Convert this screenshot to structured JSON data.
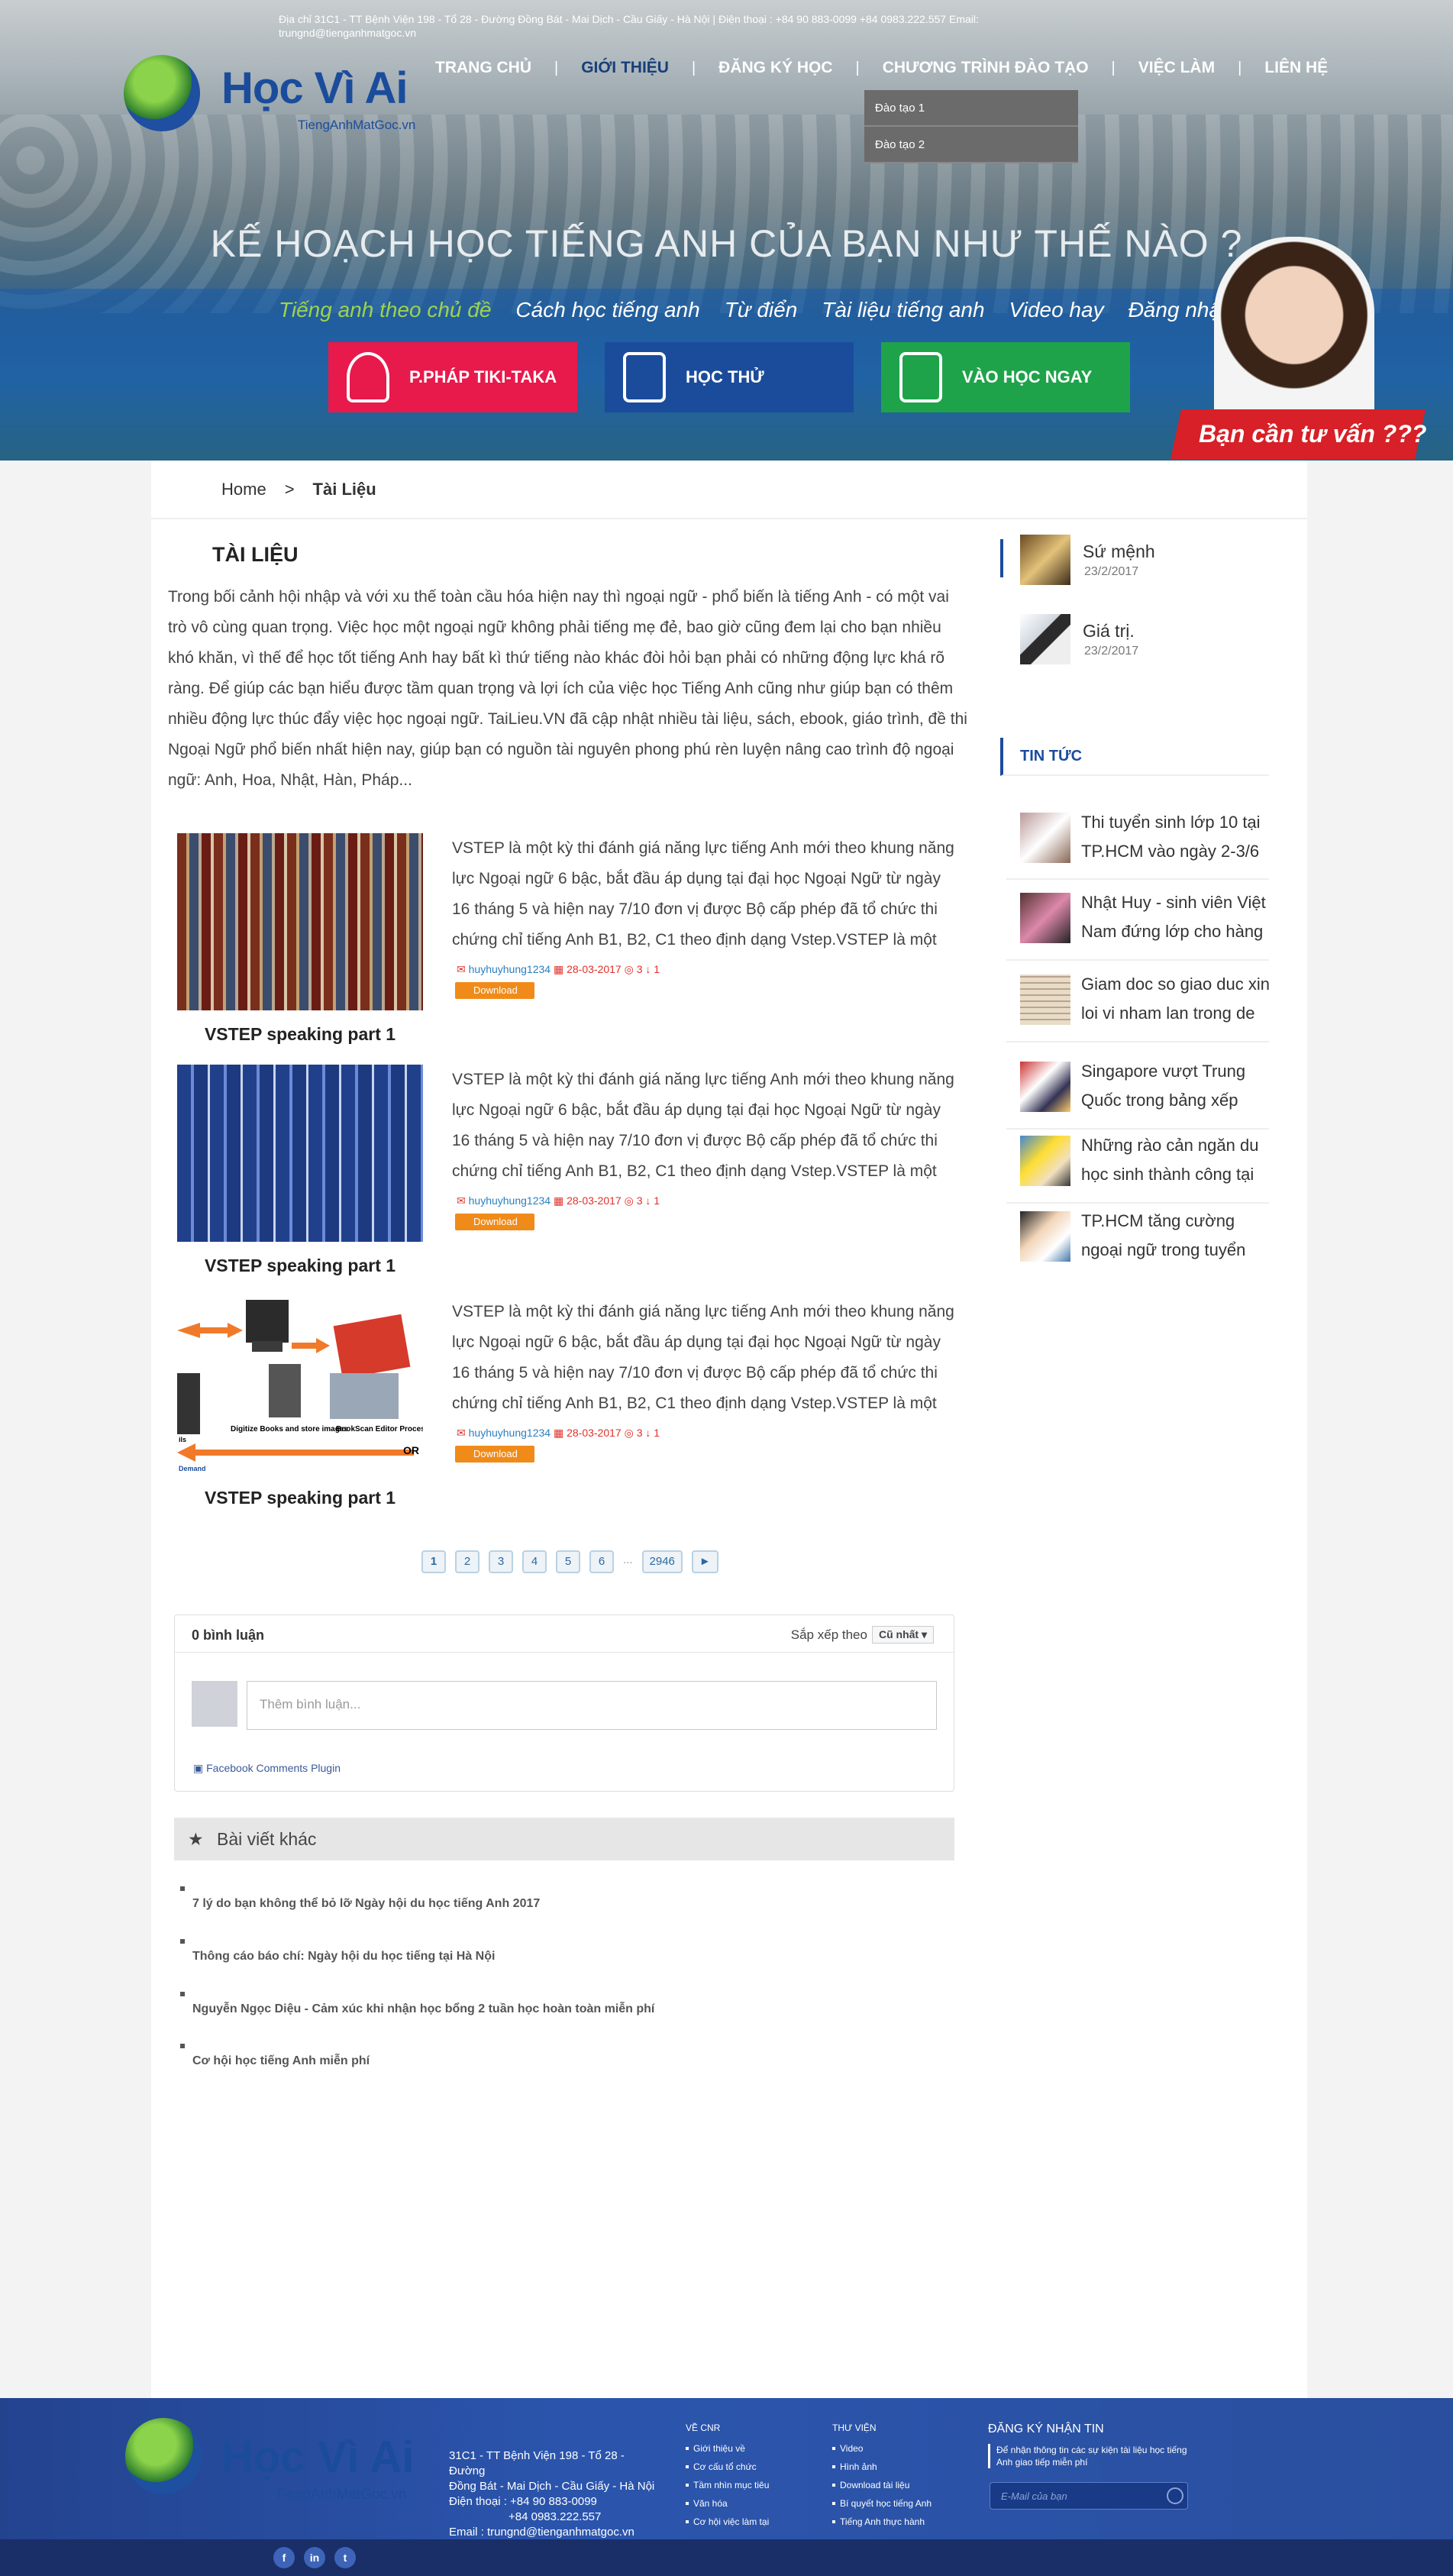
{
  "topbar": {
    "address": "Địa chỉ 31C1 - TT Bệnh Viện 198 - Tổ 28 - Đường Đồng Bát - Mai Dịch - Cầu Giấy - Hà Nội | Điện thoại : +84 90 883-0099 +84 0983.222.557 Email:",
    "email": "trungnd@tienganhmatgoc.vn"
  },
  "logo": {
    "name": "Học Vì Ai",
    "sub": "TiengAnhMatGoc.vn"
  },
  "nav": {
    "items": [
      "TRANG CHỦ",
      "GIỚI THIỆU",
      "ĐĂNG KÝ HỌC",
      "CHƯƠNG TRÌNH ĐÀO TẠO",
      "VIỆC LÀM",
      "LIÊN HỆ"
    ],
    "active_index": 1,
    "dropdown": [
      "Đào tạo 1",
      "Đào tạo 2"
    ]
  },
  "hero": {
    "title": "KẾ HOẠCH HỌC TIẾNG ANH CỦA BẠN NHƯ THẾ NÀO ?",
    "subnav": [
      "Tiếng anh theo chủ đề",
      "Cách học tiếng anh",
      "Từ điển",
      "Tài liệu tiếng anh",
      "Video hay",
      "Đăng nhập"
    ],
    "buttons": [
      {
        "label": "P.PHÁP TIKI-TAKA",
        "color": "#e8194b"
      },
      {
        "label": "HỌC THỬ",
        "color": "#1b4c9c"
      },
      {
        "label": "VÀO HỌC NGAY",
        "color": "#1ea34a"
      }
    ],
    "consult": "Bạn cần tư vấn ???"
  },
  "breadcrumb": {
    "home": "Home",
    "sep": ">",
    "current": "Tài Liệu"
  },
  "page": {
    "title": "TÀI LIỆU",
    "intro": "Trong bối cảnh hội nhập và với xu thế toàn cầu hóa hiện nay thì ngoại ngữ - phổ biến là tiếng Anh - có một vai trò vô cùng quan trọng. Việc học một ngoại ngữ không phải tiếng mẹ đẻ, bao giờ cũng đem lại cho bạn nhiều khó khăn, vì thế để học tốt tiếng Anh hay bất kì thứ tiếng nào khác đòi hỏi bạn phải có những động lực khá rõ ràng. Để giúp các bạn hiểu được tầm quan trọng và lợi ích của việc học Tiếng Anh cũng như giúp bạn có thêm nhiều động lực thúc đẩy việc học ngoại ngữ. TaiLieu.VN đã cập nhật nhiều tài liệu, sách, ebook, giáo trình, đề thi Ngoại Ngữ phổ biến nhất hiện nay, giúp bạn có nguồn tài nguyên phong phú rèn luyện nâng cao trình độ ngoại ngữ: Anh, Hoa, Nhật, Hàn, Pháp..."
  },
  "documents": [
    {
      "caption": "VSTEP speaking part 1",
      "thumb": "books-icon",
      "desc": "VSTEP là một kỳ thi đánh giá năng lực tiếng Anh mới theo khung năng lực Ngoại ngữ 6 bậc, bắt đầu áp dụng tại đại học Ngoại Ngữ từ ngày 16 tháng 5 và hiện nay 7/10 đơn vị được Bộ cấp phép đã tổ chức thi chứng chỉ tiếng Anh B1, B2, C1 theo định dạng Vstep.VSTEP là một kỳ",
      "user": "huyhuyhung1234",
      "date": "28-03-2017",
      "views": "3",
      "downloads": "1",
      "download_label": "Download"
    },
    {
      "caption": "VSTEP speaking part 1",
      "thumb": "binders-icon",
      "desc": "VSTEP là một kỳ thi đánh giá năng lực tiếng Anh mới theo khung năng lực Ngoại ngữ 6 bậc, bắt đầu áp dụng tại đại học Ngoại Ngữ từ ngày 16 tháng 5 và hiện nay 7/10 đơn vị được Bộ cấp phép đã tổ chức thi chứng chỉ tiếng Anh B1, B2, C1 theo định dạng Vstep.VSTEP là một kỳ",
      "user": "huyhuyhung1234",
      "date": "28-03-2017",
      "views": "3",
      "downloads": "1",
      "download_label": "Download"
    },
    {
      "caption": "VSTEP speaking part 1",
      "thumb": "scanner-diagram-icon",
      "desc": "VSTEP là một kỳ thi đánh giá năng lực tiếng Anh mới theo khung năng lực Ngoại ngữ 6 bậc, bắt đầu áp dụng tại đại học Ngoại Ngữ từ ngày 16 tháng 5 và hiện nay 7/10 đơn vị được Bộ cấp phép đã tổ chức thi chứng chỉ tiếng Anh B1, B2, C1 theo định dạng Vstep.VSTEP là một kỳ",
      "user": "huyhuyhung1234",
      "date": "28-03-2017",
      "views": "3",
      "downloads": "1",
      "download_label": "Download",
      "diagram_labels": [
        "Digitize Books and store images",
        "BookScan Editor Process & QC",
        "OR",
        "Demand",
        "ils"
      ]
    }
  ],
  "pagination": [
    "1",
    "2",
    "3",
    "4",
    "5",
    "6",
    "...",
    "2946",
    "►"
  ],
  "comments": {
    "count_label": "0 bình luận",
    "sort_label": "Sắp xếp theo",
    "sort_value": "Cũ nhất",
    "placeholder": "Thêm bình luận...",
    "plugin": "Facebook Comments Plugin"
  },
  "other_posts": {
    "header": "Bài viết khác",
    "items": [
      "7 lý do bạn không thể bỏ lỡ Ngày hội du học tiếng Anh 2017",
      "Thông cáo báo chí: Ngày hội du học tiếng tại Hà Nội",
      "Nguyễn Ngọc Diệu - Cảm xúc khi nhận học bổng 2 tuần học hoàn toàn miễn phí",
      "Cơ hội học tiếng Anh miễn phí"
    ]
  },
  "sidebar": {
    "top_items": [
      {
        "title": "Sứ mệnh",
        "date": "23/2/2017"
      },
      {
        "title": "Giá trị.",
        "date": "23/2/2017"
      }
    ],
    "news_header": "TIN TỨC",
    "news": [
      "Thi tuyển sinh lớp 10 tại TP.HCM vào ngày 2-3/6",
      "Nhật Huy - sinh viên Việt Nam đứng lớp cho hàng",
      "Giam doc so giao duc xin loi vi nham lan trong de thi",
      "Singapore vượt Trung Quốc trong bảng xếp hạng",
      "Những rào cản ngăn du học sinh thành công tại",
      "TP.HCM tăng cường ngoại ngữ trong tuyển sinh đầu"
    ]
  },
  "footer": {
    "address_lines": [
      "31C1 - TT Bệnh Viện 198 - Tổ 28 - Đường",
      "Đồng Bát - Mai Dịch - Cầu Giấy - Hà Nội",
      "Điện thoại : +84 90 883-0099",
      "+84 0983.222.557",
      "Email : trungnd@tienganhmatgoc.vn"
    ],
    "col1": {
      "title": "VỀ CNR",
      "items": [
        "Giới thiệu về",
        "Cơ cấu tổ chức",
        "Tầm nhìn mục tiêu",
        "Văn hóa",
        "Cơ hội việc làm tại"
      ]
    },
    "col2": {
      "title": "THƯ VIỆN",
      "items": [
        "Video",
        "Hình ảnh",
        "Download tài liệu",
        "Bí quyết học tiếng Anh",
        "Tiếng Anh thực hành"
      ]
    },
    "subscribe": {
      "title": "ĐĂNG KÝ NHẬN TIN",
      "desc": "Để nhận thông tin các sự kiện tài liệu học tiếng Anh giao tiếp miễn phí",
      "placeholder": "E-Mail của bạn"
    },
    "social": [
      "f",
      "in",
      "t"
    ]
  }
}
